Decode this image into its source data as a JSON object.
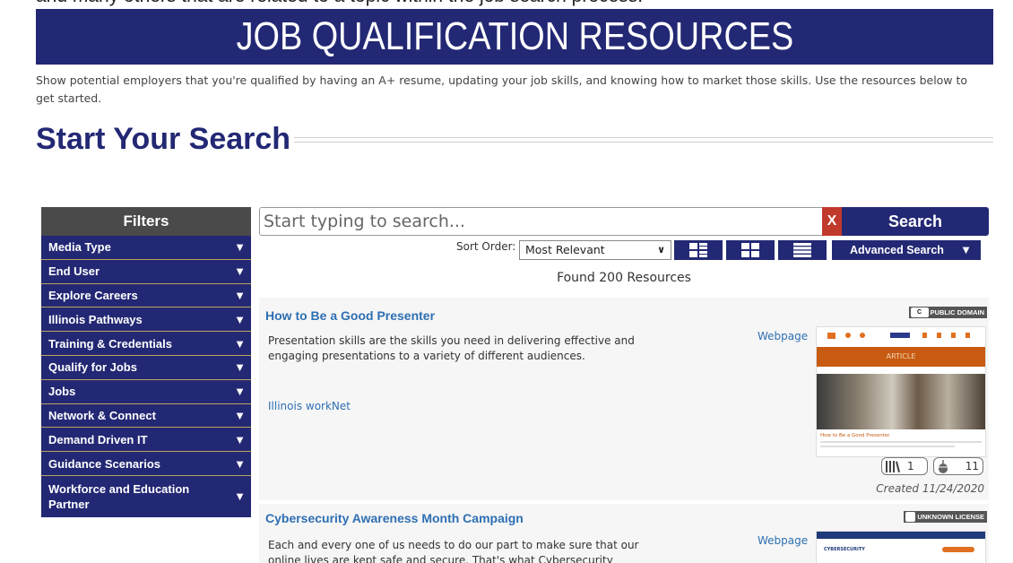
{
  "clipped_text": "and many others that are related to a topic within the job search process.",
  "banner": {
    "title": "JOB QUALIFICATION RESOURCES"
  },
  "intro": "Show potential employers that you're qualified by having an A+ resume, updating your job skills, and knowing how to market those skills. Use the resources below to get started.",
  "section_title": "Start Your Search",
  "filters": {
    "heading": "Filters",
    "items": [
      {
        "label": "Media Type"
      },
      {
        "label": "End User"
      },
      {
        "label": "Explore Careers"
      },
      {
        "label": "Illinois Pathways"
      },
      {
        "label": "Training & Credentials"
      },
      {
        "label": "Qualify for Jobs"
      },
      {
        "label": "Jobs"
      },
      {
        "label": "Network & Connect"
      },
      {
        "label": "Demand Driven IT"
      },
      {
        "label": "Guidance Scenarios"
      },
      {
        "label": "Workforce and Education Partner"
      }
    ],
    "arrow": "▼"
  },
  "search": {
    "placeholder": "Start typing to search...",
    "clear_label": "X",
    "button_label": "Search"
  },
  "sort": {
    "label": "Sort Order:",
    "selected": "Most Relevant"
  },
  "view_buttons": [
    {
      "name": "list-detail-view",
      "icon": "list-detail-icon"
    },
    {
      "name": "grid-view",
      "icon": "grid-icon"
    },
    {
      "name": "list-view",
      "icon": "list-icon"
    }
  ],
  "advanced_search": {
    "label": "Advanced Search",
    "arrow": "▼"
  },
  "results_count": "Found 200 Resources",
  "results": [
    {
      "title": "How to Be a Good Presenter",
      "description": "Presentation skills are the skills you need in delivering effective and engaging presentations to a variety of different audiences.",
      "type": "Webpage",
      "source": "Illinois workNet",
      "license": "PUBLIC DOMAIN",
      "license_icon": "C",
      "thumbnail": {
        "banner": "ARTICLE",
        "caption": "How to Be a Good Presenter"
      },
      "saves": "1",
      "views": "11",
      "created": "Created 11/24/2020"
    },
    {
      "title": "Cybersecurity Awareness Month Campaign",
      "description": "Each and every one of us needs to do our part to make sure that our online lives are kept safe and secure. That's what Cybersecurity",
      "type": "Webpage",
      "license": "UNKNOWN LICENSE",
      "thumbnail": {
        "caption": "CYBERSECURITY"
      }
    }
  ],
  "colors": {
    "navy": "#232874",
    "filters_header": "#4a4a4a",
    "link_blue": "#2e6fb3",
    "clear_red": "#c0392b"
  }
}
